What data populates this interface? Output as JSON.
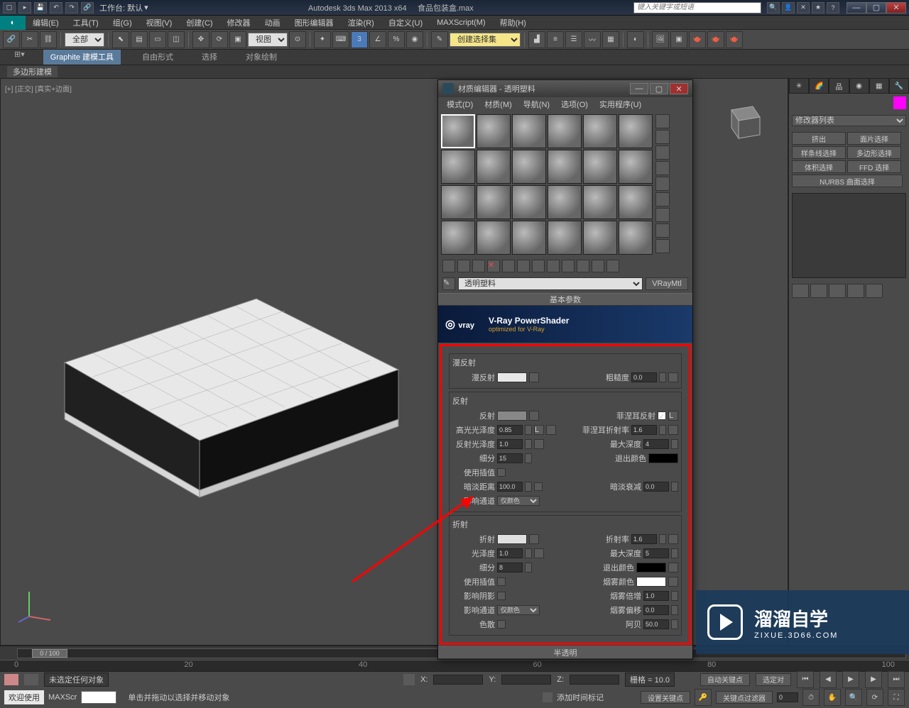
{
  "titlebar": {
    "workspace_label": "工作台: 默认",
    "app_title": "Autodesk 3ds Max  2013 x64",
    "file_name": "食品包装盒.max",
    "search_placeholder": "键入关键字或短语"
  },
  "menubar": [
    "编辑(E)",
    "工具(T)",
    "组(G)",
    "视图(V)",
    "创建(C)",
    "修改器",
    "动画",
    "图形编辑器",
    "渲染(R)",
    "自定义(U)",
    "MAXScript(M)",
    "帮助(H)"
  ],
  "toolbar": {
    "selection_filter": "全部",
    "view_label": "视图",
    "create_set": "创建选择集"
  },
  "ribbon": {
    "tabs": [
      "Graphite 建模工具",
      "自由形式",
      "选择",
      "对象绘制"
    ],
    "subtab": "多边形建模"
  },
  "viewport": {
    "label": "[+] [正交] [真实+边面]"
  },
  "cmdpanel": {
    "modifier_list_label": "修改器列表",
    "buttons": [
      "挤出",
      "面片选择",
      "样条线选择",
      "多边形选择",
      "体积选择",
      "FFD 选择"
    ],
    "nurbs_label": "NURBS 曲面选择"
  },
  "mateditor": {
    "title": "材质编辑器 - 透明塑料",
    "menus": [
      "模式(D)",
      "材质(M)",
      "导航(N)",
      "选项(O)",
      "实用程序(U)"
    ],
    "material_name": "透明塑料",
    "material_type": "VRayMtl",
    "rollout_basic": "基本参数",
    "vray": {
      "brand": "vray",
      "title": "V-Ray PowerShader",
      "subtitle": "optimized for V-Ray"
    },
    "diffuse": {
      "group": "漫反射",
      "label": "漫反射",
      "rough_label": "粗糙度",
      "rough_val": "0.0"
    },
    "reflect": {
      "group": "反射",
      "label": "反射",
      "hilight_label": "高光光泽度",
      "hilight_val": "0.85",
      "reflgloss_label": "反射光泽度",
      "reflgloss_val": "1.0",
      "subdiv_label": "细分",
      "subdiv_val": "15",
      "interp_label": "使用插值",
      "dim_label": "暗淡距离",
      "dim_val": "100.0",
      "channel_label": "影响通道",
      "channel_val": "仅颜色",
      "fresnel_label": "菲涅耳反射",
      "fresnel_ior_label": "菲涅耳折射率",
      "fresnel_ior_val": "1.6",
      "maxdepth_label": "最大深度",
      "maxdepth_val": "4",
      "exit_label": "退出颜色",
      "dimfall_label": "暗淡衰减",
      "dimfall_val": "0.0",
      "lock": "L"
    },
    "refract": {
      "group": "折射",
      "label": "折射",
      "gloss_label": "光泽度",
      "gloss_val": "1.0",
      "subdiv_label": "细分",
      "subdiv_val": "8",
      "interp_label": "使用插值",
      "shadow_label": "影响阴影",
      "channel_label": "影响通道",
      "channel_val": "仅颜色",
      "ior_label": "折射率",
      "ior_val": "1.6",
      "maxdepth_label": "最大深度",
      "maxdepth_val": "5",
      "exit_label": "退出颜色",
      "fog_label": "烟雾颜色",
      "fogmult_label": "烟雾倍增",
      "fogmult_val": "1.0",
      "fogbias_label": "烟雾偏移",
      "fogbias_val": "0.0",
      "disp_label": "色散",
      "abbe_label": "阿贝",
      "abbe_val": "50.0"
    },
    "translucent_rollout": "半透明"
  },
  "timeline": {
    "frame": "0 / 100"
  },
  "status": {
    "no_select": "未选定任何对象",
    "x": "X:",
    "y": "Y:",
    "z": "Z:",
    "grid": "栅格 = 10.0",
    "autokey": "自动关键点",
    "selected": "选定对",
    "setkey": "设置关键点",
    "keyfilter": "关键点过滤器"
  },
  "prompt": {
    "welcome": "欢迎使用",
    "maxscr": "MAXScr",
    "hint": "单击并拖动以选择并移动对象",
    "addtime": "添加时间标记"
  },
  "watermark": {
    "title": "溜溜自学",
    "url": "ZIXUE.3D66.COM"
  }
}
